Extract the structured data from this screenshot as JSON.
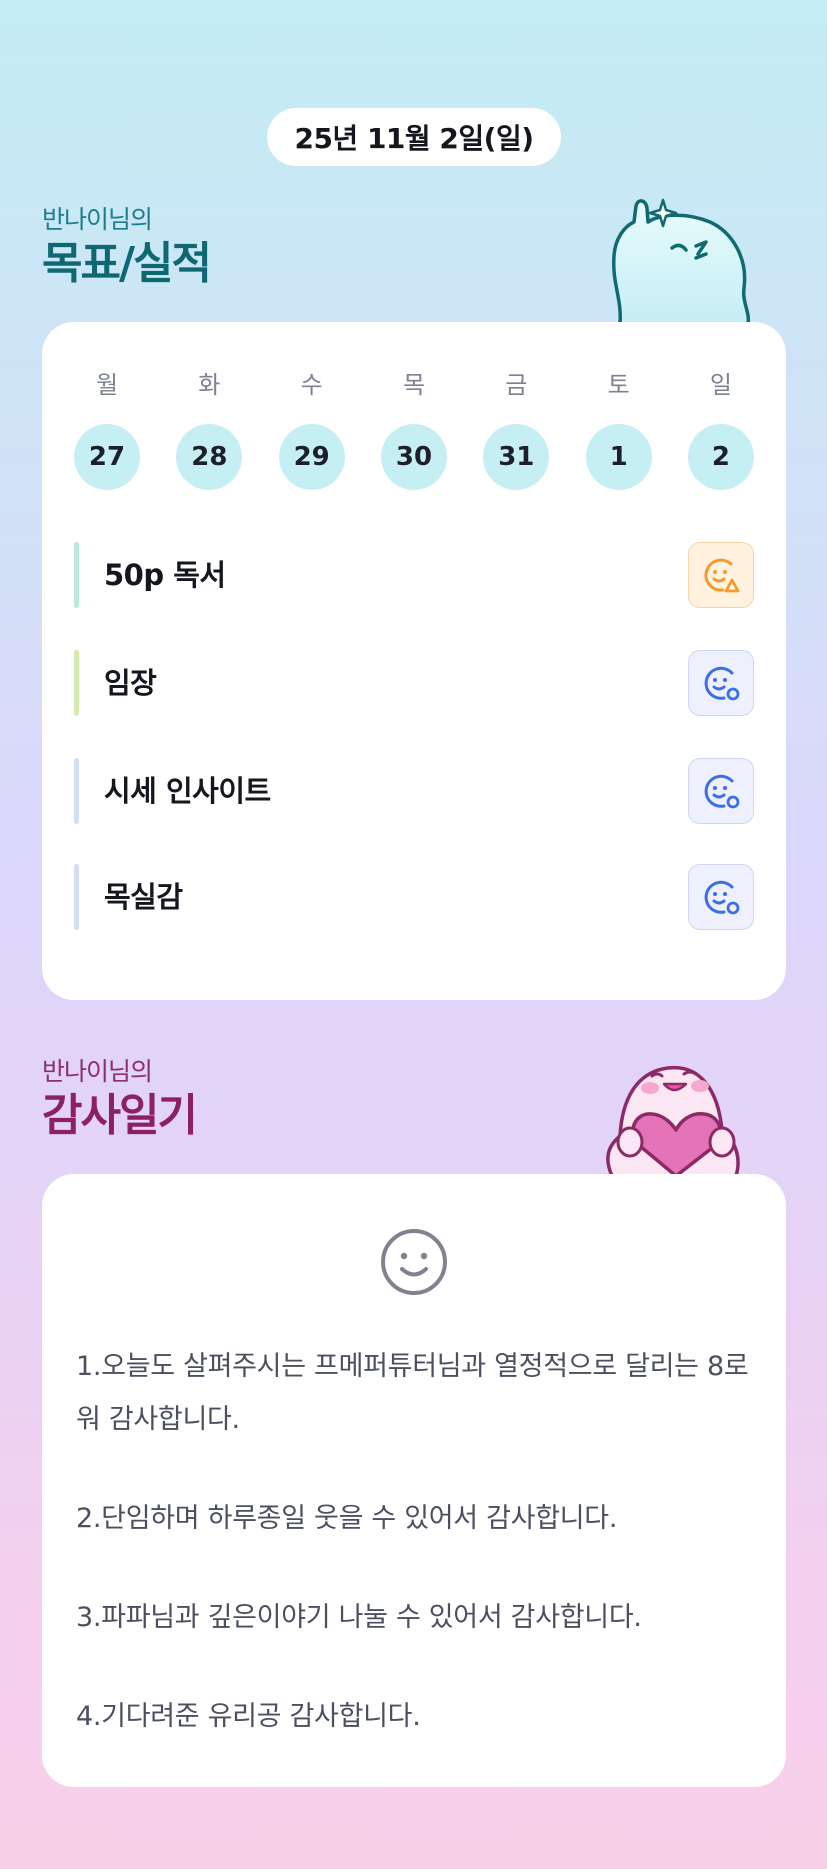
{
  "date": "25년 11월 2일(일)",
  "goals_section": {
    "subtitle": "반나이님의",
    "title": "목표/실적",
    "accent_color": "#0f6772"
  },
  "week": [
    {
      "dow": "월",
      "day": "27"
    },
    {
      "dow": "화",
      "day": "28"
    },
    {
      "dow": "수",
      "day": "29"
    },
    {
      "dow": "목",
      "day": "30"
    },
    {
      "dow": "금",
      "day": "31"
    },
    {
      "dow": "토",
      "day": "1"
    },
    {
      "dow": "일",
      "day": "2"
    }
  ],
  "goals": [
    {
      "label": "50p 독서",
      "status_icon": "smile-warning-icon",
      "bar_color": "#b7ead8"
    },
    {
      "label": "임장",
      "status_icon": "smile-check-icon",
      "bar_color": "#d4ebb0"
    },
    {
      "label": "시세 인사이트",
      "status_icon": "smile-check-icon",
      "bar_color": "#d3ddf7"
    },
    {
      "label": "목실감",
      "status_icon": "smile-check-icon",
      "bar_color": "#d3ddf7"
    }
  ],
  "diary_section": {
    "subtitle": "반나이님의",
    "title": "감사일기",
    "accent_color": "#8c2062",
    "mood_icon": "smile-icon",
    "entries": [
      "1.오늘도 살펴주시는 프메퍼튜터님과 열정적으로 달리는 8로워 감사합니다.",
      "2.단임하며 하루종일 웃을 수 있어서 감사합니다.",
      "3.파파님과 깊은이야기 나눌 수 있어서 감사합니다.",
      "4.기다려준 유리공 감사합니다."
    ]
  },
  "colors": {
    "day_circle": "#c6eff4",
    "status_warn": "#f59a2c",
    "status_ok": "#3b6fe8"
  }
}
